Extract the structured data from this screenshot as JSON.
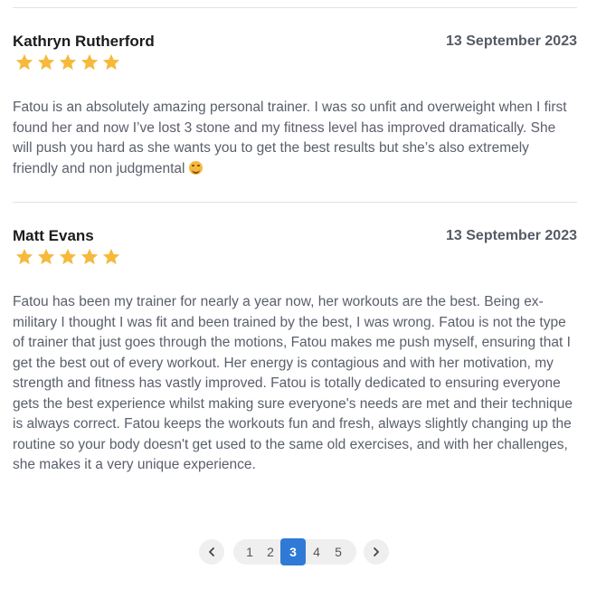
{
  "reviews": [
    {
      "name": "Kathryn Rutherford",
      "date": "13 September 2023",
      "rating": 5,
      "text": "Fatou is an absolutely amazing personal trainer. I was so unfit and overweight when I first found her and now I’ve lost 3 stone and my fitness level has improved dramatically. She will push you hard as she wants you to get the best results but she’s also extremely friendly and non judgmental"
    },
    {
      "name": "Matt Evans",
      "date": "13 September 2023",
      "rating": 5,
      "text": "Fatou has been my trainer for nearly a year now, her workouts are the best. Being ex-military I thought I was fit and been trained by the best, I was wrong. Fatou is not the type of trainer that just goes through the motions, Fatou makes me push myself, ensuring that I get the best out of every workout. Her energy is contagious and with her motivation, my strength and fitness has vastly improved. Fatou is totally dedicated to ensuring everyone gets the best experience whilst making sure everyone's needs are met and their technique is always correct. Fatou keeps the workouts fun and fresh, always slightly changing up the routine so your body doesn't get used to the same old exercises, and with her challenges, she makes it a very unique experience."
    }
  ],
  "pagination": {
    "prev_icon": "chevron-left-icon",
    "next_icon": "chevron-right-icon",
    "pages": [
      "1",
      "2",
      "3",
      "4",
      "5"
    ],
    "current_page": "3"
  },
  "colors": {
    "star": "#f6b93b",
    "active_page": "#2f7ad6"
  }
}
